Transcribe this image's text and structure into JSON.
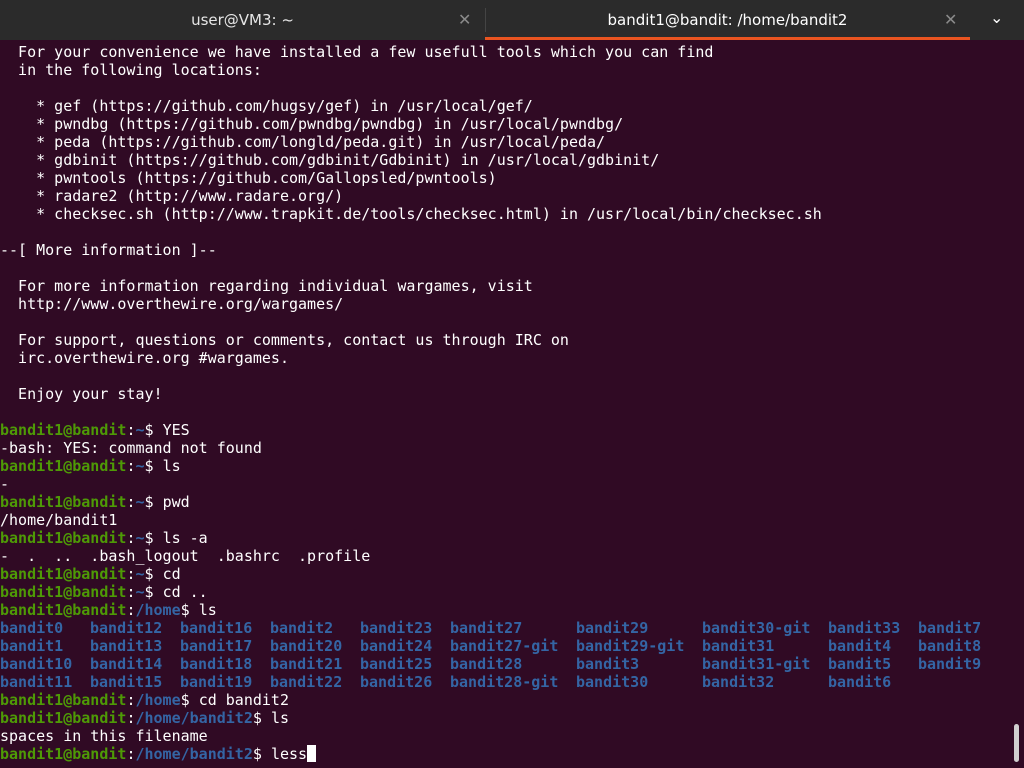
{
  "tabs": [
    {
      "title": "user@VM3: ~",
      "close": "✕"
    },
    {
      "title": "bandit1@bandit: /home/bandit2",
      "close": "✕"
    }
  ],
  "menu_icon": "⌄",
  "motd": [
    "  For your convenience we have installed a few usefull tools which you can find",
    "  in the following locations:",
    "",
    "    * gef (https://github.com/hugsy/gef) in /usr/local/gef/",
    "    * pwndbg (https://github.com/pwndbg/pwndbg) in /usr/local/pwndbg/",
    "    * peda (https://github.com/longld/peda.git) in /usr/local/peda/",
    "    * gdbinit (https://github.com/gdbinit/Gdbinit) in /usr/local/gdbinit/",
    "    * pwntools (https://github.com/Gallopsled/pwntools)",
    "    * radare2 (http://www.radare.org/)",
    "    * checksec.sh (http://www.trapkit.de/tools/checksec.html) in /usr/local/bin/checksec.sh",
    "",
    "--[ More information ]--",
    "",
    "  For more information regarding individual wargames, visit",
    "  http://www.overthewire.org/wargames/",
    "",
    "  For support, questions or comments, contact us through IRC on",
    "  irc.overthewire.org #wargames.",
    "",
    "  Enjoy your stay!",
    ""
  ],
  "prompt_user": "bandit1@bandit",
  "commands": [
    {
      "path": "~",
      "cmd": "YES",
      "output": [
        "-bash: YES: command not found"
      ]
    },
    {
      "path": "~",
      "cmd": "ls",
      "output": [
        "-"
      ]
    },
    {
      "path": "~",
      "cmd": "pwd",
      "output": [
        "/home/bandit1"
      ]
    },
    {
      "path": "~",
      "cmd": "ls -a",
      "output": [
        "-  .  ..  .bash_logout  .bashrc  .profile"
      ]
    },
    {
      "path": "~",
      "cmd": "cd",
      "output": []
    },
    {
      "path": "~",
      "cmd": "cd ..",
      "output": []
    },
    {
      "path": "/home",
      "cmd": "ls",
      "output": []
    }
  ],
  "ls_home": [
    [
      "bandit0",
      "bandit12",
      "bandit16",
      "bandit2",
      "bandit23",
      "bandit27",
      "bandit29",
      "bandit30-git",
      "bandit33",
      "bandit7"
    ],
    [
      "bandit1",
      "bandit13",
      "bandit17",
      "bandit20",
      "bandit24",
      "bandit27-git",
      "bandit29-git",
      "bandit31",
      "bandit4",
      "bandit8"
    ],
    [
      "bandit10",
      "bandit14",
      "bandit18",
      "bandit21",
      "bandit25",
      "bandit28",
      "bandit3",
      "bandit31-git",
      "bandit5",
      "bandit9"
    ],
    [
      "bandit11",
      "bandit15",
      "bandit19",
      "bandit22",
      "bandit26",
      "bandit28-git",
      "bandit30",
      "bandit32",
      "bandit6",
      ""
    ]
  ],
  "commands_after": [
    {
      "path": "/home",
      "cmd": "cd bandit2",
      "output": []
    },
    {
      "path": "/home/bandit2",
      "cmd": "ls",
      "output": [
        "spaces in this filename"
      ]
    }
  ],
  "current": {
    "path": "/home/bandit2",
    "input": "less"
  }
}
